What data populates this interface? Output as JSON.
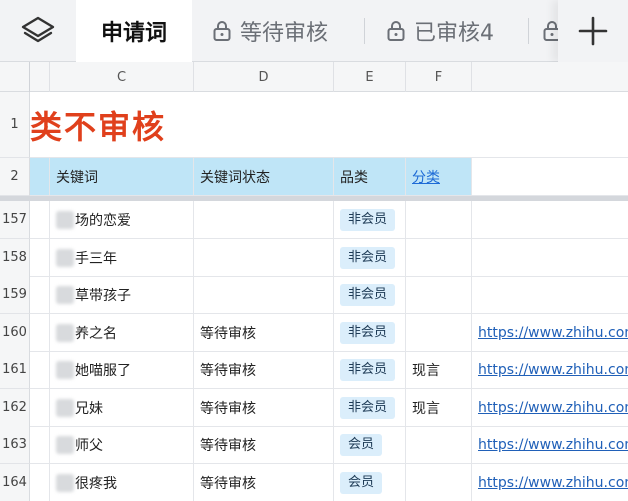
{
  "tabs": [
    {
      "label": "申请词",
      "locked": false,
      "active": true
    },
    {
      "label": "等待审核",
      "locked": true,
      "active": false
    },
    {
      "label": "已审核4",
      "locked": true,
      "active": false
    },
    {
      "label": "",
      "locked": true,
      "active": false
    }
  ],
  "columns": [
    "C",
    "D",
    "E",
    "F"
  ],
  "title_row": {
    "row": "1",
    "text": "类不审核"
  },
  "header_row": {
    "row": "2",
    "keyword": "关键词",
    "status": "关键词状态",
    "category": "品类",
    "classify": "分类"
  },
  "rows": [
    {
      "row": "157",
      "keyword": "场的恋爱",
      "status": "",
      "category": "非会员",
      "classify": "",
      "link": ""
    },
    {
      "row": "158",
      "keyword": "手三年",
      "status": "",
      "category": "非会员",
      "classify": "",
      "link": ""
    },
    {
      "row": "159",
      "keyword": "草带孩子",
      "status": "",
      "category": "非会员",
      "classify": "",
      "link": ""
    },
    {
      "row": "160",
      "keyword": "养之名",
      "status": "等待审核",
      "category": "非会员",
      "classify": "",
      "link": "https://www.zhihu.com"
    },
    {
      "row": "161",
      "keyword": "她喵服了",
      "status": "等待审核",
      "category": "非会员",
      "classify": "现言",
      "link": "https://www.zhihu.com"
    },
    {
      "row": "162",
      "keyword": "兄妹",
      "status": "等待审核",
      "category": "非会员",
      "classify": "现言",
      "link": "https://www.zhihu.com"
    },
    {
      "row": "163",
      "keyword": "师父",
      "status": "等待审核",
      "category": "会员",
      "classify": "",
      "link": "https://www.zhihu.com"
    },
    {
      "row": "164",
      "keyword": "很疼我",
      "status": "等待审核",
      "category": "会员",
      "classify": "",
      "link": "https://www.zhihu.com"
    }
  ]
}
